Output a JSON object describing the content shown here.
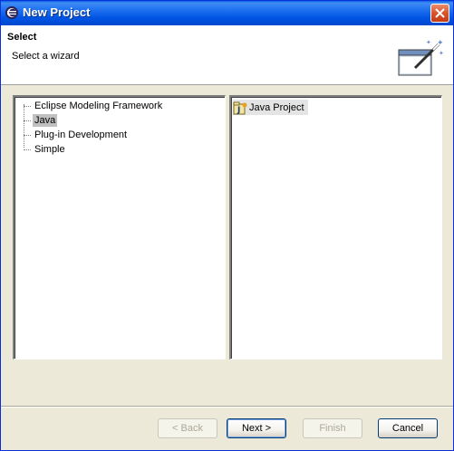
{
  "window": {
    "title": "New Project",
    "app_icon": "eclipse-icon",
    "close_icon": "close-icon"
  },
  "header": {
    "title": "Select",
    "description": "Select a wizard",
    "icon": "wizard-wand-icon"
  },
  "tree": {
    "items": [
      {
        "label": "Eclipse Modeling Framework",
        "selected": false
      },
      {
        "label": "Java",
        "selected": true
      },
      {
        "label": "Plug-in Development",
        "selected": false
      },
      {
        "label": "Simple",
        "selected": false
      }
    ]
  },
  "wizards": {
    "items": [
      {
        "label": "Java Project",
        "icon": "java-project-icon",
        "selected": true
      }
    ]
  },
  "buttons": {
    "back": "< Back",
    "next": "Next >",
    "finish": "Finish",
    "cancel": "Cancel"
  },
  "colors": {
    "titlebar": "#0054e3",
    "dialog_bg": "#ece9d8",
    "selection": "#c0c0c0"
  }
}
